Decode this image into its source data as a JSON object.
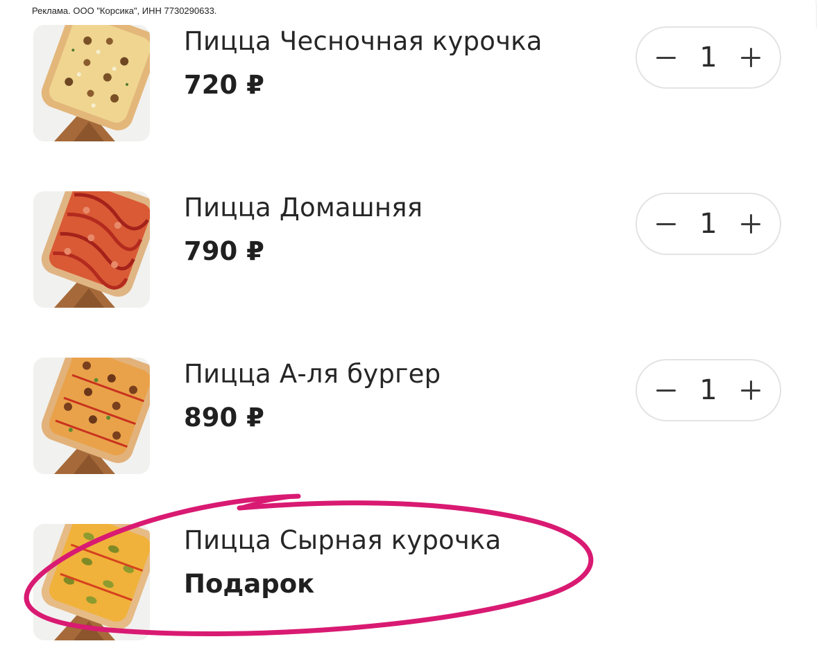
{
  "ad_disclaimer": "Реклама. ООО \"Корсика\", ИНН 7730290633.",
  "accent_color": "#d91a72",
  "cart_items": [
    {
      "title": "Пицца Чесночная курочка",
      "price": "720 ₽",
      "quantity": "1",
      "image_icon": "pizza-garlic-chicken-image"
    },
    {
      "title": "Пицца Домашняя",
      "price": "790 ₽",
      "quantity": "1",
      "image_icon": "pizza-homemade-image"
    },
    {
      "title": "Пицца А-ля бургер",
      "price": "890 ₽",
      "quantity": "1",
      "image_icon": "pizza-burger-image"
    },
    {
      "title": "Пицца Сырная курочка",
      "price": "Подарок",
      "image_icon": "pizza-cheese-chicken-image"
    }
  ]
}
